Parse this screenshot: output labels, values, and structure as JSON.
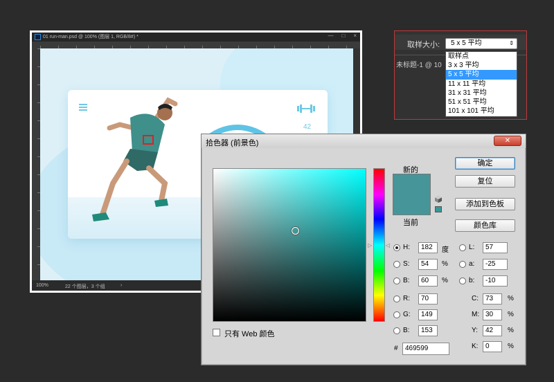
{
  "document": {
    "title": "01 run-man.psd @ 100% (图层 1, RGB/8#) *",
    "window_buttons": [
      "—",
      "□",
      "×"
    ],
    "status_zoom": "100%",
    "status_info": "22 个图层，3 个组",
    "status_arrow": "›",
    "card_number": "42"
  },
  "sampler": {
    "label": "取样大小:",
    "selected": "5 x 5 平均",
    "arrow": "⇕",
    "doc_tab": "未标题-1 @ 10",
    "options": [
      "取样点",
      "3 x 3 平均",
      "5 x 5 平均",
      "11 x 11 平均",
      "31 x 31 平均",
      "51 x 51 平均",
      "101 x 101 平均"
    ],
    "selected_index": 2
  },
  "picker": {
    "title": "拾色器 (前景色)",
    "close": "✕",
    "new_label": "新的",
    "current_label": "当前",
    "buttons": {
      "ok": "确定",
      "reset": "复位",
      "add_swatch": "添加到色板",
      "libraries": "颜色库"
    },
    "web_only": "只有 Web 颜色",
    "hsb": {
      "h_label": "H:",
      "h_value": "182",
      "h_unit": "度",
      "s_label": "S:",
      "s_value": "54",
      "s_unit": "%",
      "b_label": "B:",
      "b_value": "60",
      "b_unit": "%"
    },
    "rgb": {
      "r_label": "R:",
      "r_value": "70",
      "g_label": "G:",
      "g_value": "149",
      "b_label": "B:",
      "b_value": "153"
    },
    "lab": {
      "l_label": "L:",
      "l_value": "57",
      "a_label": "a:",
      "a_value": "-25",
      "b_label": "b:",
      "b_value": "-10"
    },
    "cmyk": {
      "c_label": "C:",
      "c_value": "73",
      "m_label": "M:",
      "m_value": "30",
      "y_label": "Y:",
      "y_value": "42",
      "k_label": "K:",
      "k_value": "0",
      "unit": "%"
    },
    "hex_label": "#",
    "hex_value": "469599",
    "current_color": "#469599"
  }
}
